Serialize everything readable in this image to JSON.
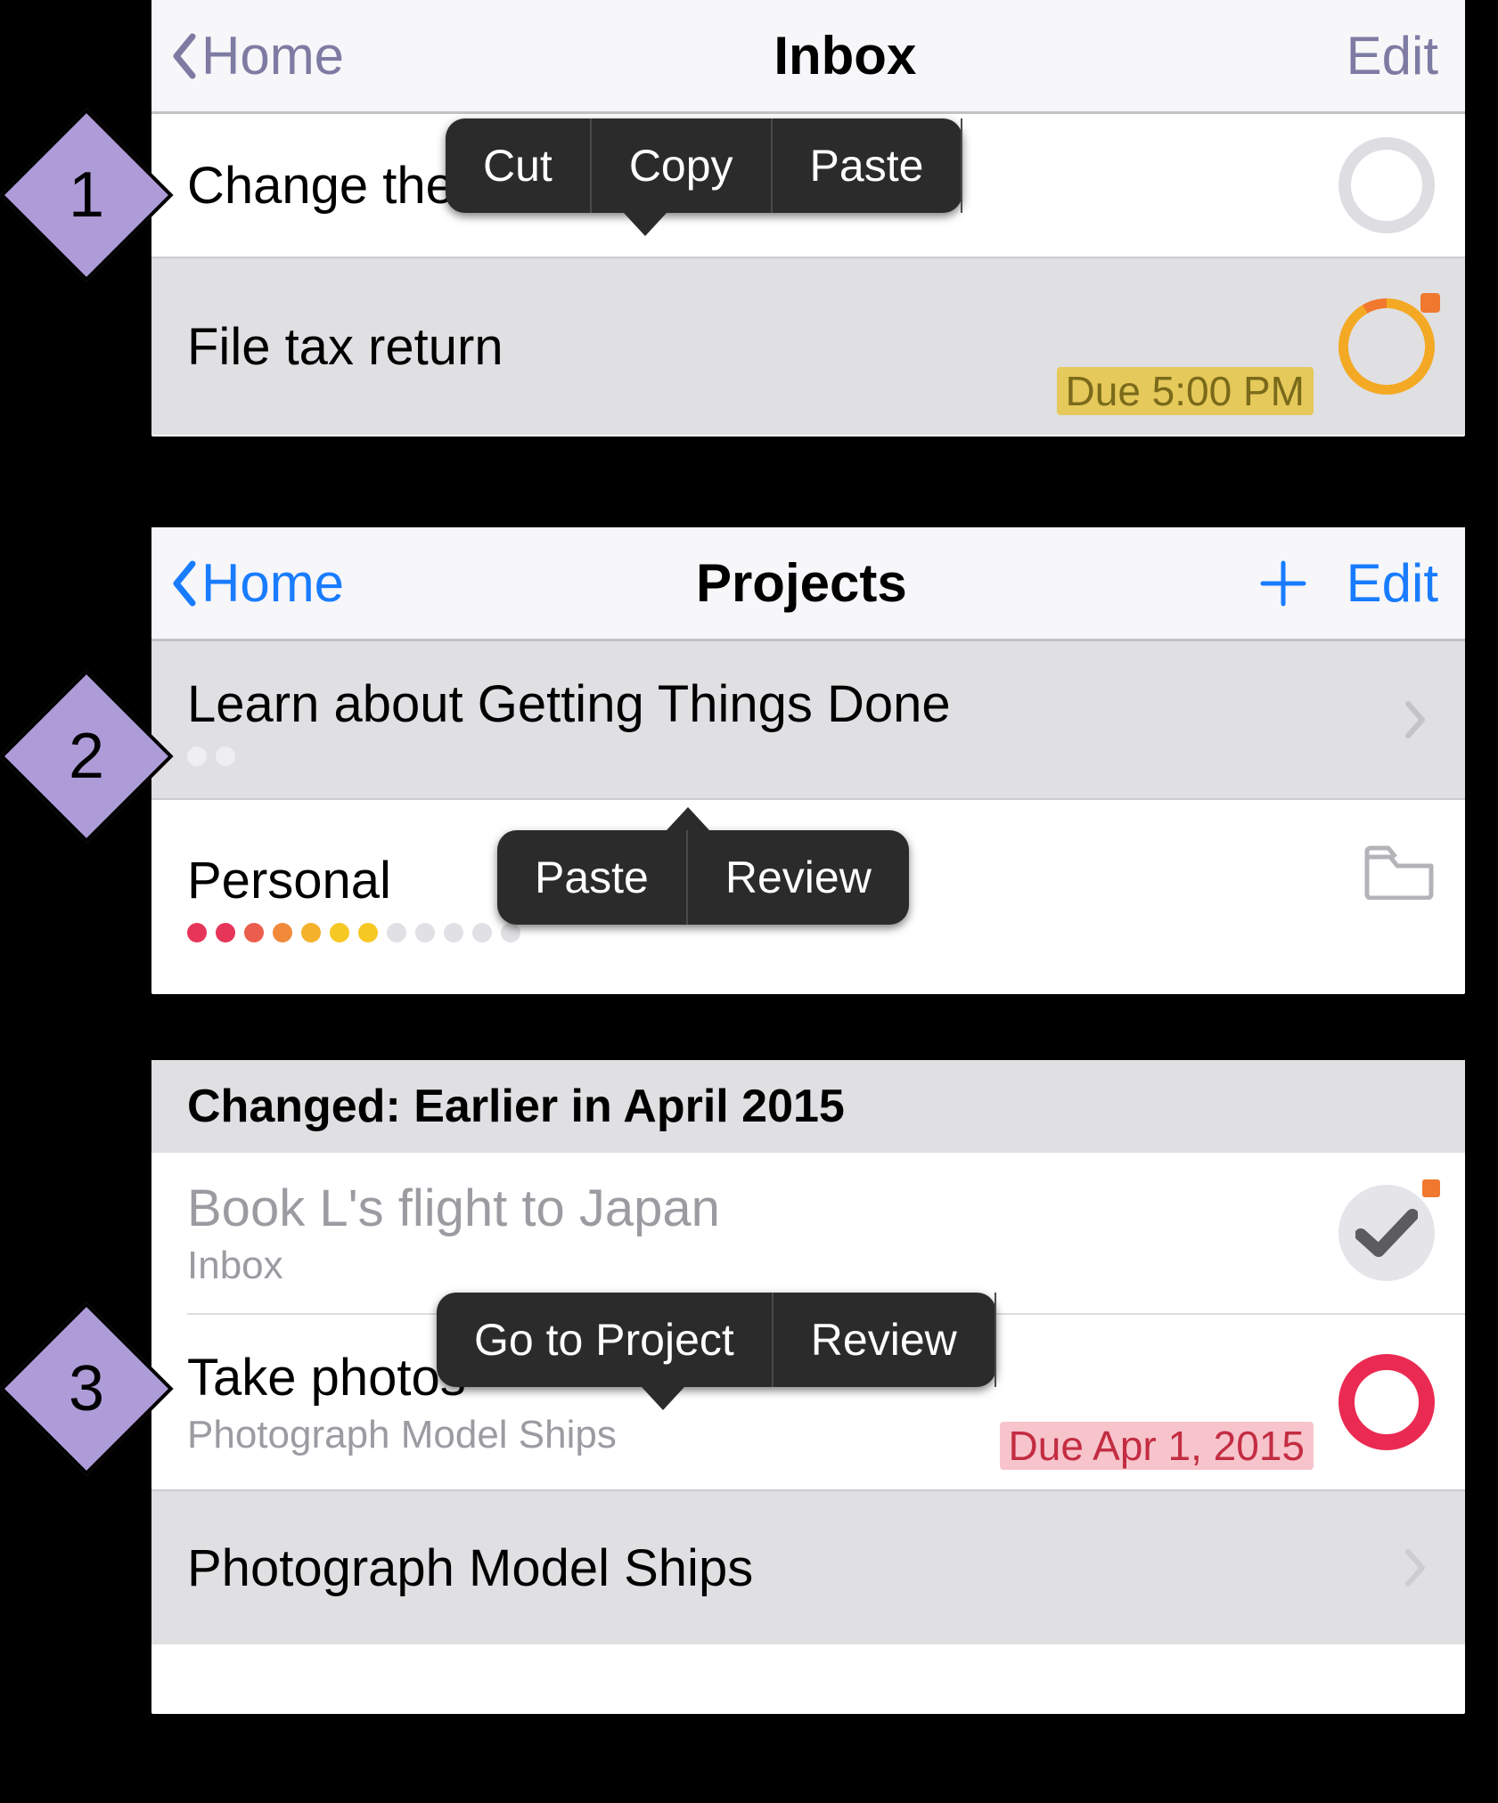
{
  "annotations": {
    "d1": "1",
    "d2": "2",
    "d3": "3"
  },
  "panel1": {
    "nav": {
      "back": "Home",
      "title": "Inbox",
      "edit": "Edit"
    },
    "rows": [
      {
        "title": "Change the"
      },
      {
        "title": "File tax return",
        "due": "Due 5:00 PM"
      }
    ],
    "popover": [
      "Cut",
      "Copy",
      "Paste"
    ]
  },
  "panel2": {
    "nav": {
      "back": "Home",
      "title": "Projects",
      "edit": "Edit"
    },
    "rows": [
      {
        "title": "Learn about Getting Things Done"
      },
      {
        "title": "Personal"
      }
    ],
    "popover": [
      "Paste",
      "Review"
    ]
  },
  "panel3": {
    "section": "Changed: Earlier in April 2015",
    "rows": [
      {
        "title": "Book L's flight to Japan",
        "meta": "Inbox"
      },
      {
        "title": "Take photos",
        "meta": "Photograph Model Ships",
        "due": "Due Apr 1, 2015"
      },
      {
        "title": "Photograph Model Ships"
      }
    ],
    "popover": [
      "Go to Project",
      "Review"
    ]
  }
}
